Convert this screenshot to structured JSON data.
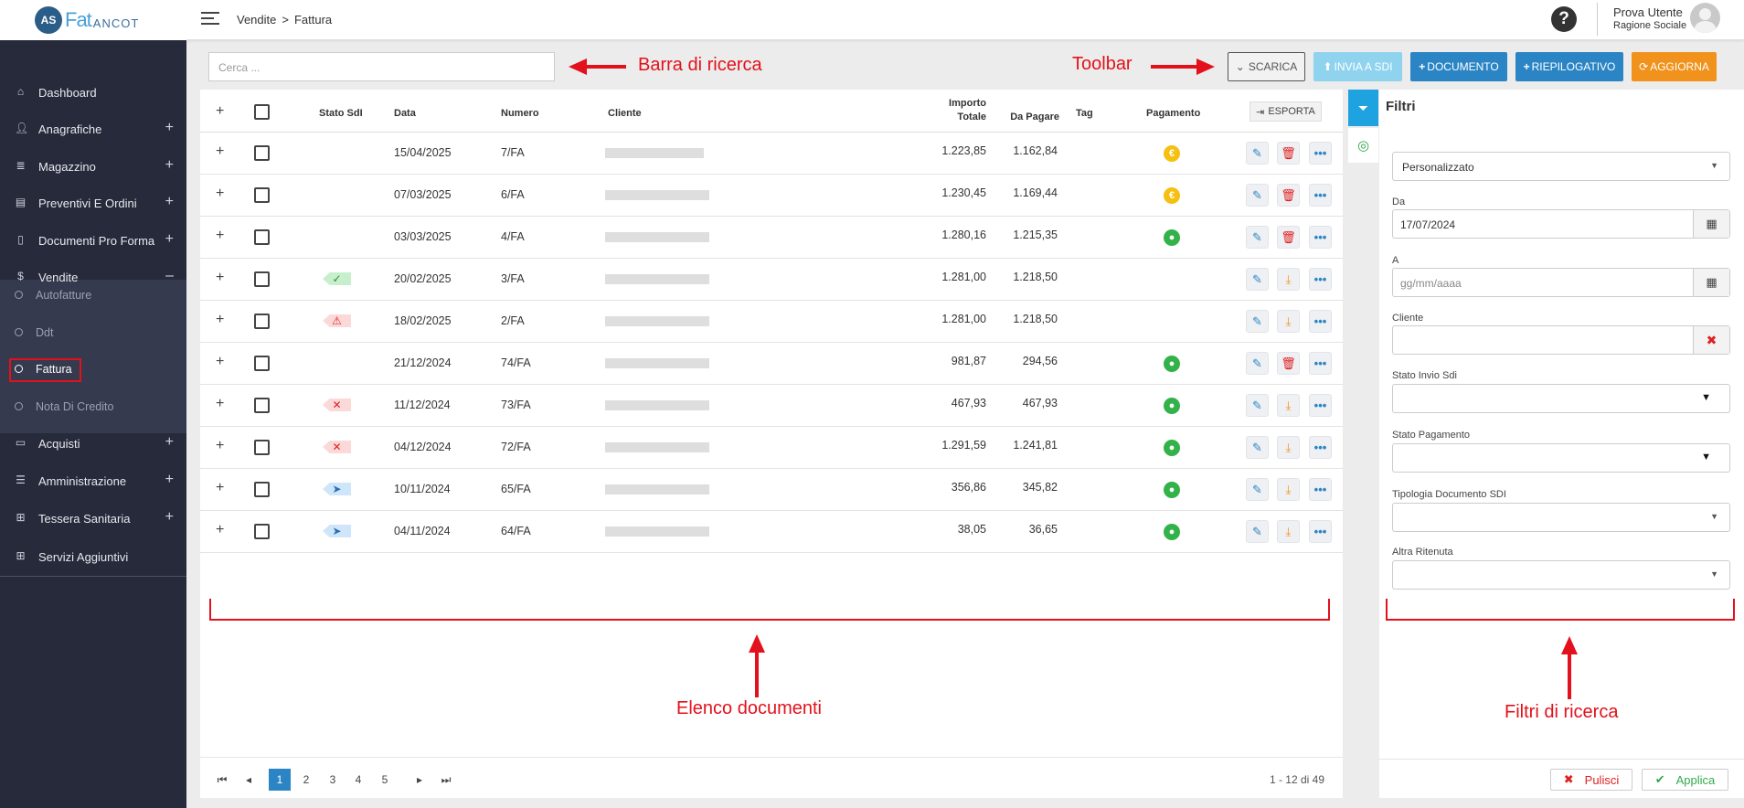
{
  "brand": {
    "logo_mark": "AS",
    "name_a": "Fat",
    "name_b": "ANCOT"
  },
  "breadcrumb": {
    "section": "Vendite",
    "sep": ">",
    "page": "Fattura"
  },
  "header": {
    "help_glyph": "?",
    "user_name": "Prova Utente",
    "user_role": "Ragione Sociale"
  },
  "sidebar": {
    "items": [
      {
        "label": "Dashboard",
        "icon": "home-icon",
        "plus": ""
      },
      {
        "label": "Anagrafiche",
        "icon": "user-icon",
        "plus": "+"
      },
      {
        "label": "Magazzino",
        "icon": "list-icon",
        "plus": "+"
      },
      {
        "label": "Preventivi E Ordini",
        "icon": "clipboard-icon",
        "plus": "+"
      },
      {
        "label": "Documenti Pro Forma",
        "icon": "file-icon",
        "plus": "+"
      },
      {
        "label": "Vendite",
        "icon": "dollar-icon",
        "plus": "–"
      },
      {
        "label": "Acquisti",
        "icon": "card-icon",
        "plus": "+"
      },
      {
        "label": "Amministrazione",
        "icon": "database-icon",
        "plus": "+"
      },
      {
        "label": "Tessera Sanitaria",
        "icon": "medkit-icon",
        "plus": "+"
      },
      {
        "label": "Servizi Aggiuntivi",
        "icon": "grid-icon",
        "plus": ""
      }
    ],
    "subitems": [
      {
        "label": "Autofatture"
      },
      {
        "label": "Ddt"
      },
      {
        "label": "Fattura"
      },
      {
        "label": "Nota Di Credito"
      }
    ]
  },
  "search": {
    "placeholder": "Cerca ..."
  },
  "toolbar": {
    "scarica": "SCARICA",
    "invia_sdi": "INVIA A SDI",
    "documento": "DOCUMENTO",
    "riepilogativo": "RIEPILOGATIVO",
    "aggiorna": "AGGIORNA"
  },
  "table": {
    "headers": {
      "expand": "+",
      "stato_sdi": "Stato SdI",
      "data": "Data",
      "numero": "Numero",
      "cliente": "Cliente",
      "importo_1": "Importo",
      "importo_2": "Totale",
      "da_pagare": "Da Pagare",
      "tag": "Tag",
      "pagamento": "Pagamento",
      "esporta": "ESPORTA"
    },
    "rows": [
      {
        "expand": "+",
        "stato": "none",
        "data": "15/04/2025",
        "numero": "7/FA",
        "importo": "1.223,85",
        "da_pagare": "1.162,84",
        "pay": "euro",
        "action2": "delete"
      },
      {
        "expand": "+",
        "stato": "none",
        "data": "07/03/2025",
        "numero": "6/FA",
        "importo": "1.230,45",
        "da_pagare": "1.169,44",
        "pay": "euro",
        "action2": "delete"
      },
      {
        "expand": "+",
        "stato": "none",
        "data": "03/03/2025",
        "numero": "4/FA",
        "importo": "1.280,16",
        "da_pagare": "1.215,35",
        "pay": "green",
        "action2": "delete"
      },
      {
        "expand": "+",
        "stato": "ok",
        "data": "20/02/2025",
        "numero": "3/FA",
        "importo": "1.281,00",
        "da_pagare": "1.218,50",
        "pay": "none",
        "action2": "download"
      },
      {
        "expand": "+",
        "stato": "warn",
        "data": "18/02/2025",
        "numero": "2/FA",
        "importo": "1.281,00",
        "da_pagare": "1.218,50",
        "pay": "none",
        "action2": "download"
      },
      {
        "expand": "+",
        "stato": "none",
        "data": "21/12/2024",
        "numero": "74/FA",
        "importo": "981,87",
        "da_pagare": "294,56",
        "pay": "green",
        "action2": "delete"
      },
      {
        "expand": "+",
        "stato": "ko",
        "data": "11/12/2024",
        "numero": "73/FA",
        "importo": "467,93",
        "da_pagare": "467,93",
        "pay": "green",
        "action2": "download"
      },
      {
        "expand": "+",
        "stato": "ko",
        "data": "04/12/2024",
        "numero": "72/FA",
        "importo": "1.291,59",
        "da_pagare": "1.241,81",
        "pay": "green",
        "action2": "download"
      },
      {
        "expand": "+",
        "stato": "send",
        "data": "10/11/2024",
        "numero": "65/FA",
        "importo": "356,86",
        "da_pagare": "345,82",
        "pay": "green",
        "action2": "download"
      },
      {
        "expand": "+",
        "stato": "send",
        "data": "04/11/2024",
        "numero": "64/FA",
        "importo": "38,05",
        "da_pagare": "36,65",
        "pay": "green",
        "action2": "download"
      }
    ]
  },
  "pagination": {
    "pages": [
      "1",
      "2",
      "3",
      "4",
      "5"
    ],
    "current": "1",
    "summary": "1 - 12 di 49"
  },
  "filters": {
    "title": "Filtri",
    "periodo": "Personalizzato",
    "da_label": "Da",
    "da_value": "17/07/2024",
    "a_label": "A",
    "a_placeholder": "gg/mm/aaaa",
    "cliente_label": "Cliente",
    "stato_invio_label": "Stato Invio Sdi",
    "stato_pagamento_label": "Stato Pagamento",
    "tipologia_label": "Tipologia Documento SDI",
    "ritenuta_label": "Altra Ritenuta",
    "pulisci": "Pulisci",
    "applica": "Applica"
  },
  "annotations": {
    "search": "Barra di ricerca",
    "toolbar": "Toolbar",
    "list": "Elenco documenti",
    "filters": "Filtri di ricerca"
  },
  "colors": {
    "sidebar_bg": "#262a3b",
    "primary": "#2b85c4",
    "orange": "#f0921b",
    "annotation": "#e3111b"
  }
}
